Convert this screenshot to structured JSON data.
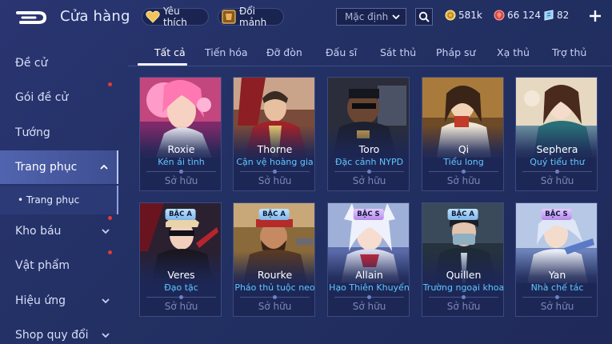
{
  "header": {
    "title": "Cửa hàng",
    "favorites_label": "Yêu thích",
    "fragments_label": "Đổi mảnh",
    "sort_value": "Mặc định",
    "currency": {
      "gold": "581k",
      "gems": "66 124",
      "vouchers": "82"
    }
  },
  "sidebar": {
    "items": [
      {
        "label": "Đề cử"
      },
      {
        "label": "Gói đề cử"
      },
      {
        "label": "Tướng"
      },
      {
        "label": "Trang phục"
      },
      {
        "label": "Kho báu"
      },
      {
        "label": "Vật phẩm"
      },
      {
        "label": "Hiệu ứng"
      },
      {
        "label": "Shop quy đổi"
      }
    ],
    "sub_item": "• Trang phục"
  },
  "tabs": [
    "Tất cả",
    "Tiến hóa",
    "Đỡ đòn",
    "Đấu sĩ",
    "Sát thủ",
    "Pháp sư",
    "Xạ thủ",
    "Trợ thủ"
  ],
  "cards": [
    {
      "hero": "Roxie",
      "skin": "Kén ái tình",
      "status": "Sở hữu"
    },
    {
      "hero": "Thorne",
      "skin": "Cận vệ hoàng gia",
      "status": "Sở hữu"
    },
    {
      "hero": "Toro",
      "skin": "Đặc cảnh NYPD",
      "status": "Sở hữu"
    },
    {
      "hero": "Qi",
      "skin": "Tiểu long",
      "status": "Sở hữu"
    },
    {
      "hero": "Sephera",
      "skin": "Quý tiểu thư",
      "status": "Sở hữu"
    },
    {
      "hero": "Veres",
      "skin": "Đạo tặc",
      "status": "Sở hữu",
      "badge": "BẬC A"
    },
    {
      "hero": "Rourke",
      "skin": "Pháo thủ tuộc neo",
      "status": "Sở hữu",
      "badge": "BẬC A"
    },
    {
      "hero": "Allain",
      "skin": "Hạo Thiên Khuyển",
      "status": "Sở hữu",
      "badge": "BẬC S"
    },
    {
      "hero": "Quillen",
      "skin": "Trường ngoại khoa",
      "status": "Sở hữu",
      "badge": "BẬC A"
    },
    {
      "hero": "Yan",
      "skin": "Nhà chế tác",
      "status": "Sở hữu",
      "badge": "BẬC S"
    }
  ]
}
